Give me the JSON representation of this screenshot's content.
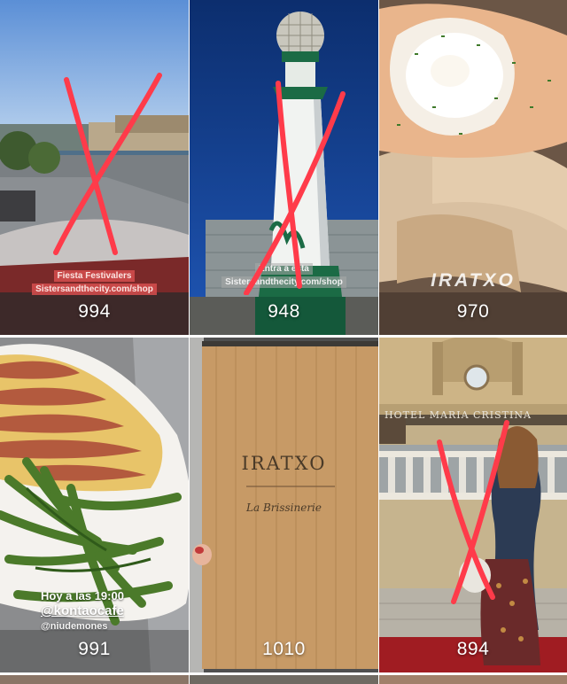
{
  "tiles": [
    {
      "count": "994",
      "caption_lines": [
        "Fiesta Festivalers",
        "Sistersandthecity.com/shop"
      ],
      "crossed": true
    },
    {
      "count": "948",
      "caption_lines": [
        "Entra a esta",
        "Sistersandthecity.com/shop"
      ],
      "crossed": true
    },
    {
      "count": "970",
      "watermark": "IRATXO",
      "crossed": false
    },
    {
      "count": "991",
      "story_lines": [
        "Hoy a las 19:00",
        "@kontaocafe",
        "@niudemones"
      ],
      "crossed": false
    },
    {
      "count": "1010",
      "menu_title": "IRATXO",
      "menu_subtitle": "La Brissinerie",
      "crossed": false
    },
    {
      "count": "894",
      "sign_text": "HOTEL MARIA CRISTINA",
      "crossed": true
    }
  ],
  "colors": {
    "cross": "#ff3b4a",
    "count_text": "#ffffff"
  }
}
